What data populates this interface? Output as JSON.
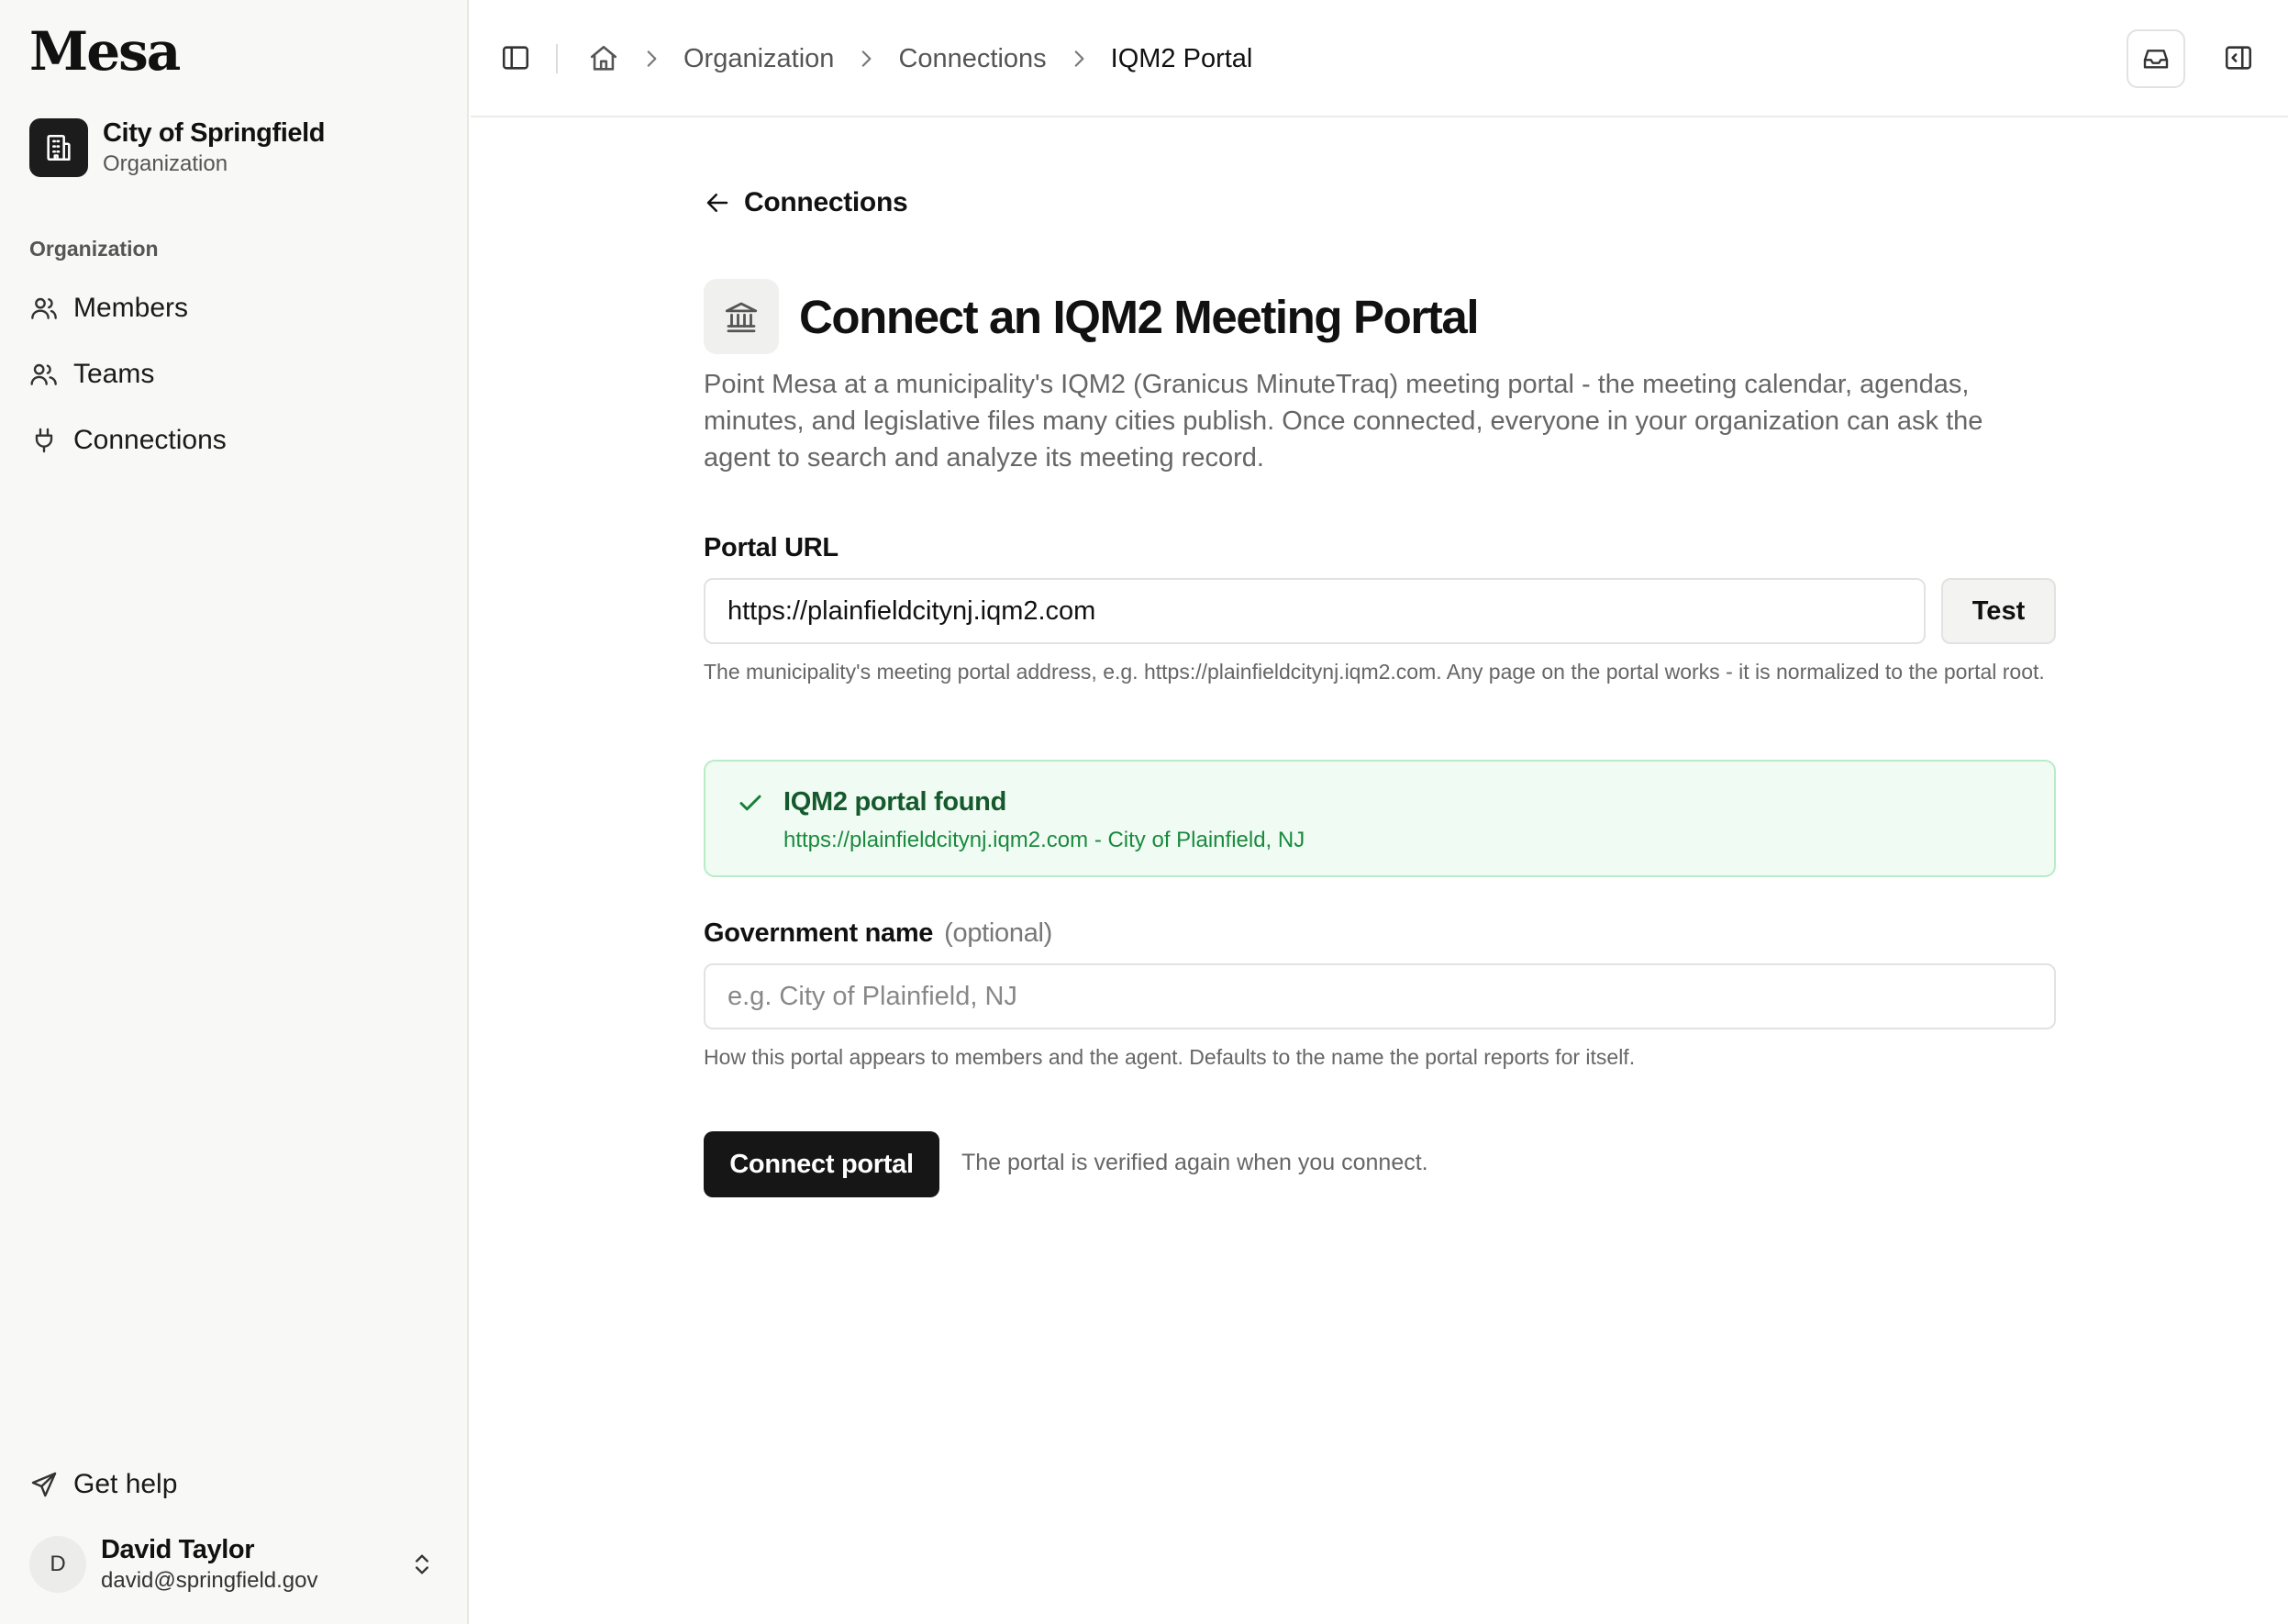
{
  "app": {
    "logo": "Mesa"
  },
  "org": {
    "name": "City of Springfield",
    "type": "Organization"
  },
  "sidebar": {
    "section_heading": "Organization",
    "items": [
      {
        "label": "Members",
        "icon": "users-icon"
      },
      {
        "label": "Teams",
        "icon": "user-group-icon"
      },
      {
        "label": "Connections",
        "icon": "plug-icon"
      }
    ],
    "help_label": "Get help"
  },
  "user": {
    "initial": "D",
    "name": "David Taylor",
    "email": "david@springfield.gov"
  },
  "breadcrumb": {
    "items": [
      "Organization",
      "Connections"
    ],
    "current": "IQM2 Portal"
  },
  "page": {
    "back_label": "Connections",
    "title": "Connect an IQM2 Meeting Portal",
    "description": "Point Mesa at a municipality's IQM2 (Granicus MinuteTraq) meeting portal - the meeting calendar, agendas, minutes, and legislative files many cities publish. Once connected, everyone in your organization can ask the agent to search and analyze its meeting record."
  },
  "form": {
    "portal_url": {
      "label": "Portal URL",
      "value": "https://plainfieldcitynj.iqm2.com",
      "test_label": "Test",
      "hint": "The municipality's meeting portal address, e.g. https://plainfieldcitynj.iqm2.com. Any page on the portal works - it is normalized to the portal root."
    },
    "status": {
      "title": "IQM2 portal found",
      "detail": "https://plainfieldcitynj.iqm2.com - City of Plainfield, NJ",
      "color": "#16803a"
    },
    "gov_name": {
      "label": "Government name",
      "optional": "(optional)",
      "placeholder": "e.g. City of Plainfield, NJ",
      "hint": "How this portal appears to members and the agent. Defaults to the name the portal reports for itself."
    },
    "submit_label": "Connect portal",
    "submit_note": "The portal is verified again when you connect."
  },
  "colors": {
    "accent": "#161616",
    "success_bg": "#f0fcf3",
    "success_border": "#b9ecc6"
  }
}
